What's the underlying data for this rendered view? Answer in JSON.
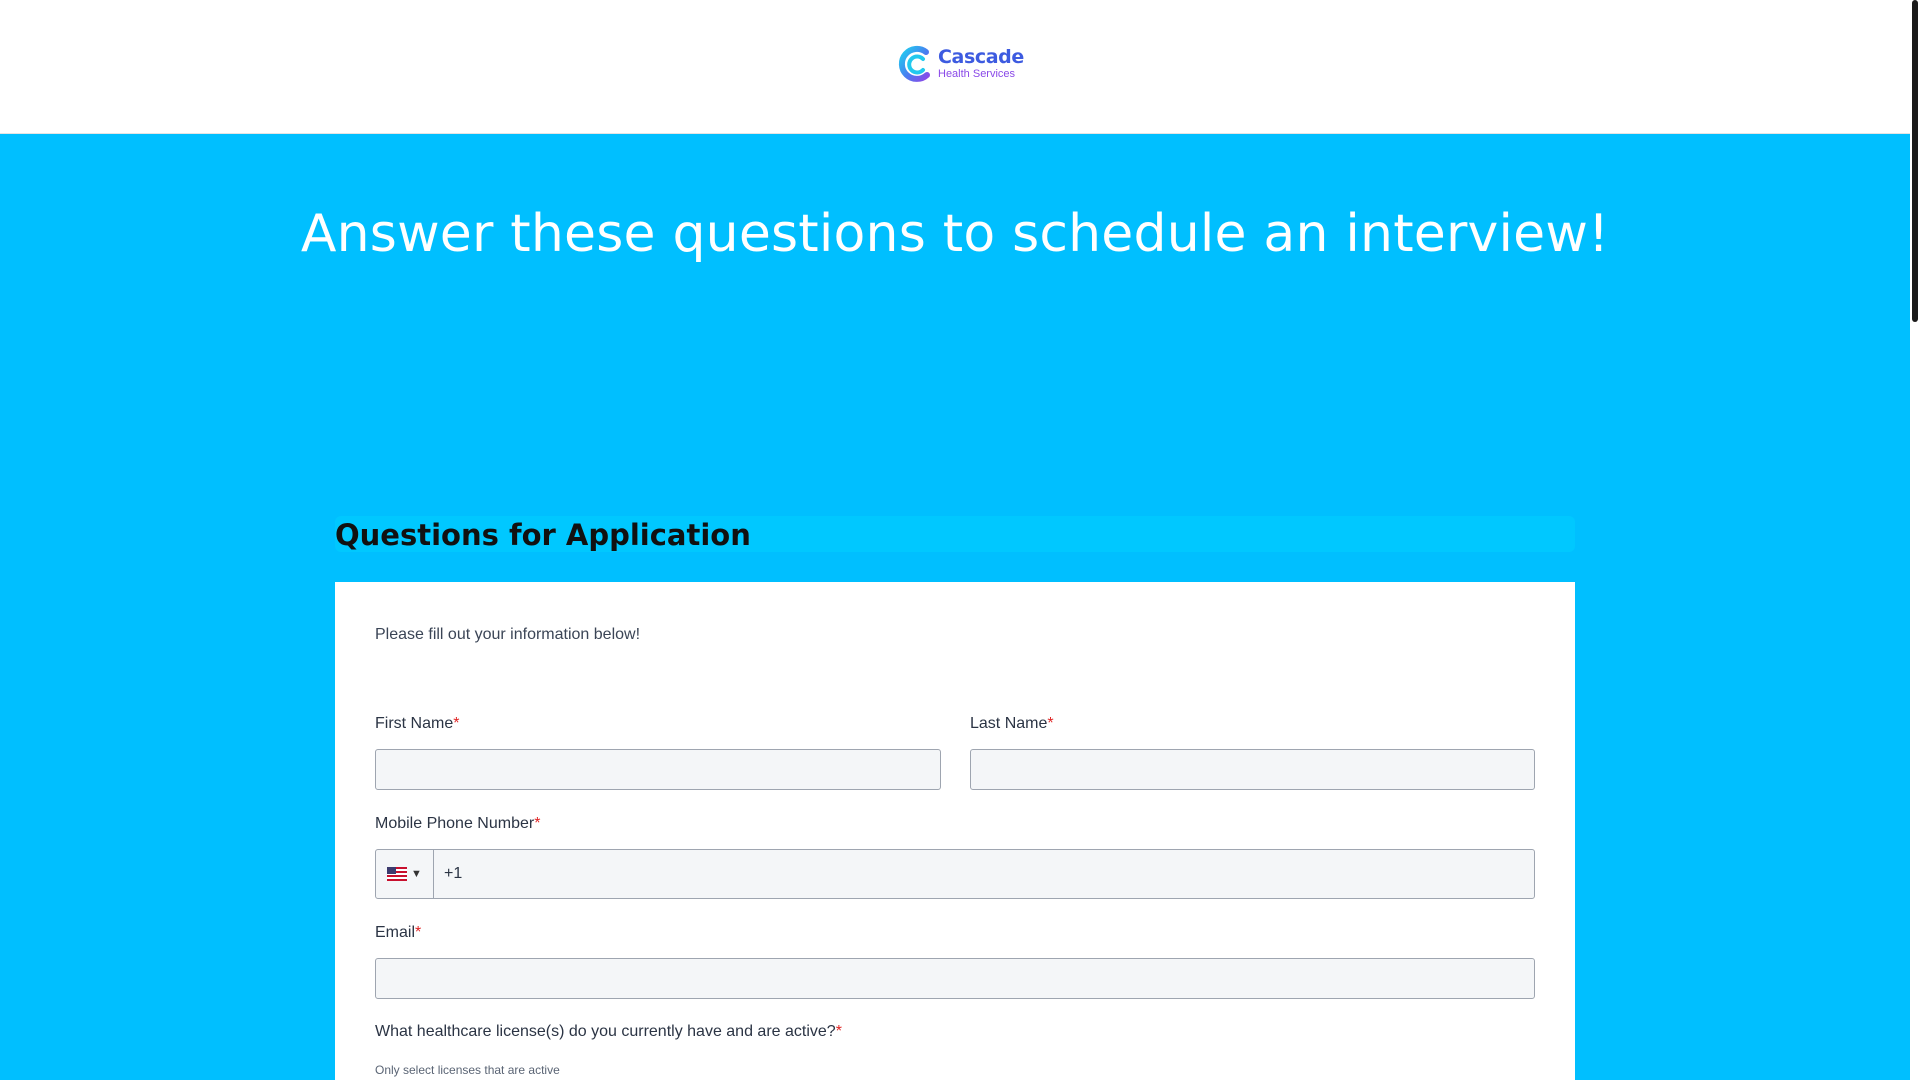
{
  "brand": {
    "name": "Cascade",
    "tagline": "Health Services",
    "colors": {
      "primary": "#3d5be0",
      "secondary": "#8a49e8",
      "accent": "#00bfff"
    }
  },
  "hero": {
    "title": "Answer these questions to schedule an interview!"
  },
  "section": {
    "title": "Questions for Application"
  },
  "form": {
    "intro": "Please fill out your information below!",
    "required_mark": "*",
    "first_name": {
      "label": "First Name",
      "value": ""
    },
    "last_name": {
      "label": "Last Name",
      "value": ""
    },
    "phone": {
      "label": "Mobile Phone Number",
      "country_icon": "us-flag-icon",
      "value": "+1"
    },
    "email": {
      "label": "Email",
      "value": ""
    },
    "licenses": {
      "label": "What healthcare license(s) do you currently have and are active?",
      "help": "Only select licenses that are active"
    }
  }
}
